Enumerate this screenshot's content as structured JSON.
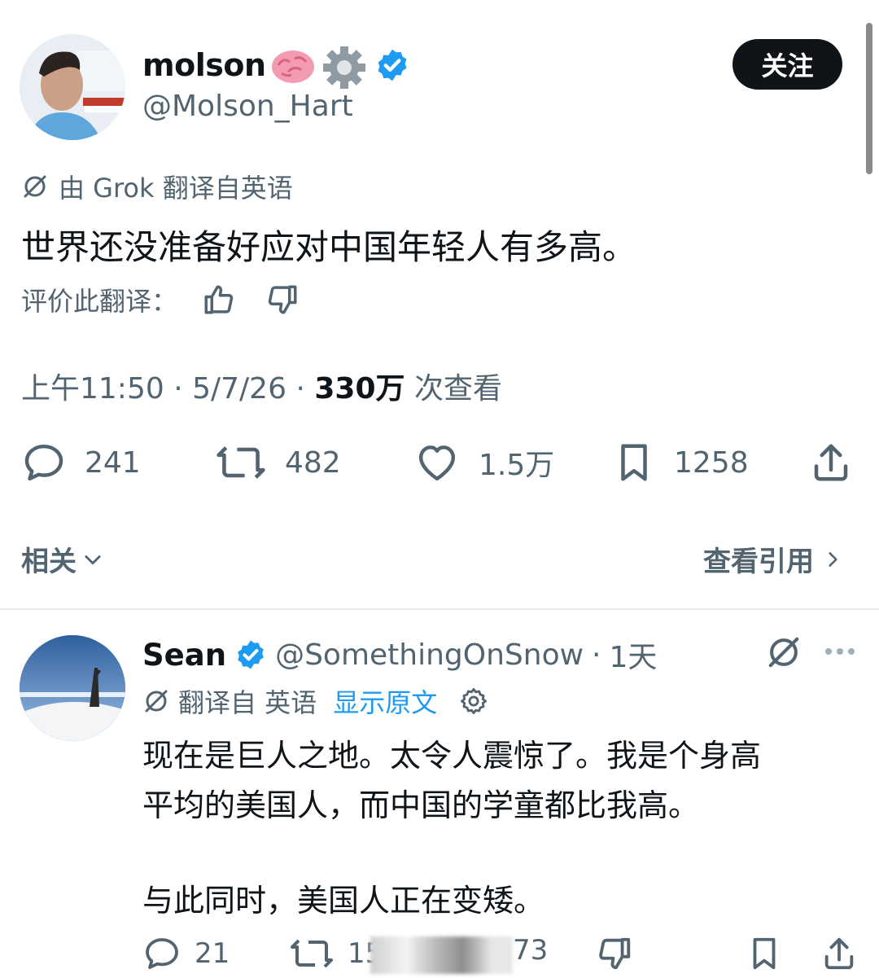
{
  "tweet": {
    "display_name": "molson",
    "name_emojis": [
      "brain-emoji",
      "gear-emoji"
    ],
    "handle": "@Molson_Hart",
    "follow_label": "关注",
    "translated_note": "由 Grok 翻译自英语",
    "text": "世界还没准备好应对中国年轻人有多高。",
    "rate_label": "评价此翻译：",
    "time": "上午11:50",
    "date": "5/7/26",
    "views_count": "330万",
    "views_label": "次查看",
    "sep": "·",
    "stats": {
      "replies": "241",
      "retweets": "482",
      "likes": "1.5万",
      "bookmarks": "1258"
    },
    "related_label": "相关",
    "view_quotes_label": "查看引用"
  },
  "reply": {
    "display_name": "Sean",
    "handle": "@SomethingOnSnow",
    "time_ago": "1天",
    "translated_from": "翻译自 英语",
    "show_original": "显示原文",
    "text_line1": "现在是巨人之地。太令人震惊了。我是个身高",
    "text_line2": "平均的美国人，而中国的学童都比我高。",
    "text_line3": "与此同时，美国人正在变矮。",
    "stats": {
      "replies": "21",
      "retweets_partial": "15",
      "likes_partial": "73"
    }
  },
  "colors": {
    "accent": "#1d9bf0",
    "text": "#0f1419",
    "muted": "#536471",
    "follow_bg": "#0f1419"
  }
}
